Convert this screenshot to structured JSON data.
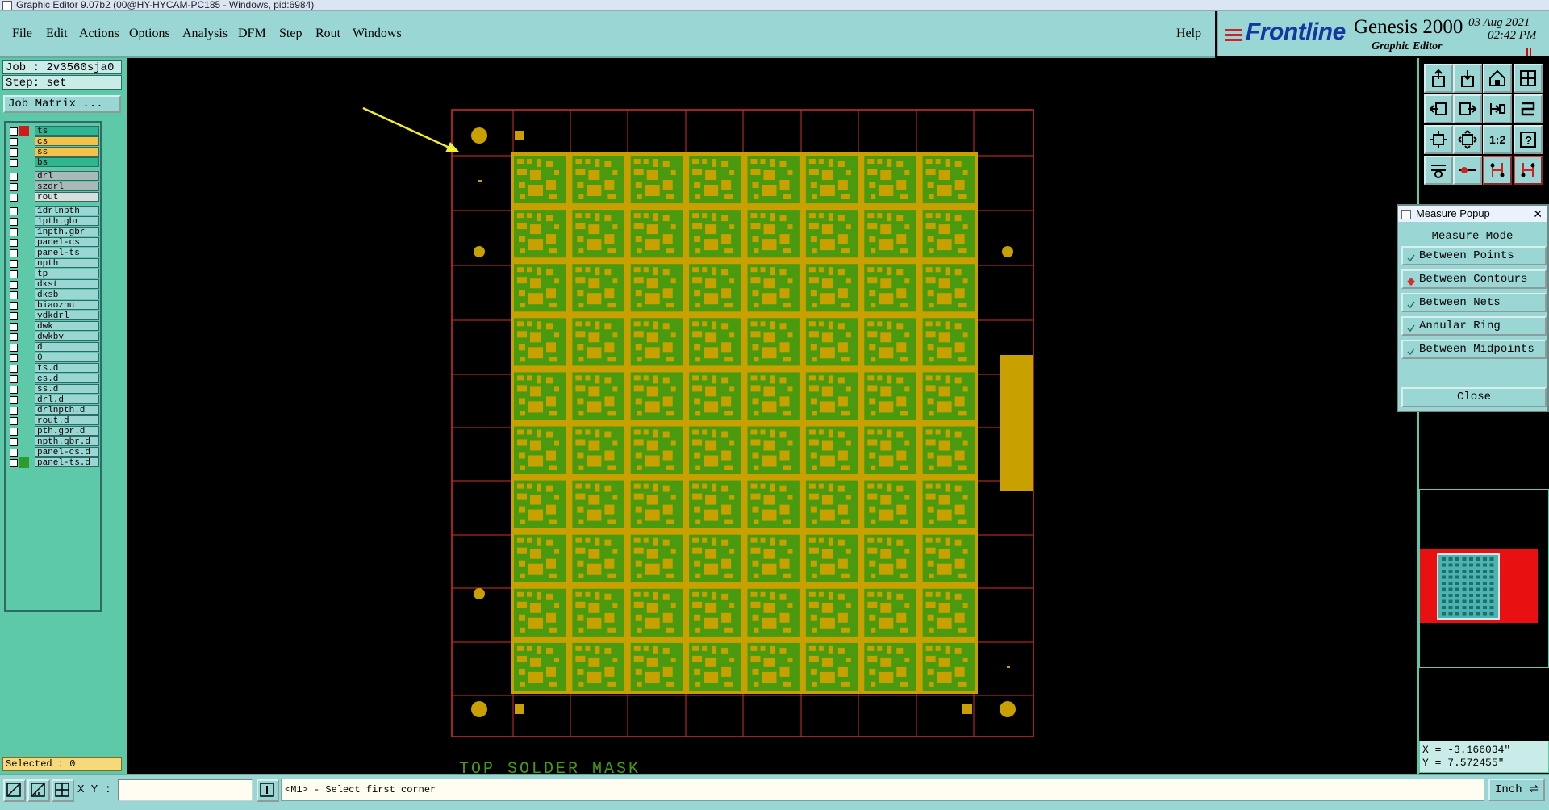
{
  "window": {
    "title": "Graphic Editor 9.07b2 (00@HY-HYCAM-PC185 - Windows, pid:6984)"
  },
  "menu": {
    "items": [
      {
        "key": "file",
        "label": "File"
      },
      {
        "key": "edit",
        "label": "Edit"
      },
      {
        "key": "actions",
        "label": "Actions"
      },
      {
        "key": "options",
        "label": "Options"
      },
      {
        "key": "analysis",
        "label": "Analysis"
      },
      {
        "key": "dfm",
        "label": "DFM"
      },
      {
        "key": "step",
        "label": "Step"
      },
      {
        "key": "rout",
        "label": "Rout"
      },
      {
        "key": "windows",
        "label": "Windows"
      }
    ],
    "help": "Help"
  },
  "brand": {
    "logo": "Frontline",
    "product": "Genesis 2000",
    "subtitle": "Graphic Editor",
    "date": "03 Aug 2021",
    "time": "02:42 PM"
  },
  "job": {
    "job_label": "Job : 2v3560sja0",
    "step_label": "Step: set",
    "matrix_button": "Job Matrix ..."
  },
  "layers": [
    {
      "name": "ts",
      "bg": "#2fb58f",
      "swatch": "#d11a1a",
      "group": 1
    },
    {
      "name": "cs",
      "bg": "#f5c24a",
      "swatch": "",
      "group": 1
    },
    {
      "name": "ss",
      "bg": "#f5c24a",
      "swatch": "",
      "group": 1
    },
    {
      "name": "bs",
      "bg": "#2fb58f",
      "swatch": "",
      "group": 1
    },
    {
      "name": "drl",
      "bg": "#a9b9ba",
      "swatch": "",
      "group": 2
    },
    {
      "name": "szdrl",
      "bg": "#a9b9ba",
      "swatch": "",
      "group": 2
    },
    {
      "name": "rout",
      "bg": "#d8dede",
      "swatch": "",
      "group": 2
    },
    {
      "name": "1drlnpth",
      "bg": "#9ad7d4",
      "swatch": "",
      "group": 3
    },
    {
      "name": "1pth.gbr",
      "bg": "#9ad7d4",
      "swatch": "",
      "group": 3
    },
    {
      "name": "1npth.gbr",
      "bg": "#9ad7d4",
      "swatch": "",
      "group": 3
    },
    {
      "name": "panel-cs",
      "bg": "#9ad7d4",
      "swatch": "",
      "group": 3
    },
    {
      "name": "panel-ts",
      "bg": "#9ad7d4",
      "swatch": "",
      "group": 3
    },
    {
      "name": "npth",
      "bg": "#9ad7d4",
      "swatch": "",
      "group": 3
    },
    {
      "name": "tp",
      "bg": "#9ad7d4",
      "swatch": "",
      "group": 3
    },
    {
      "name": "dkst",
      "bg": "#9ad7d4",
      "swatch": "",
      "group": 3
    },
    {
      "name": "dksb",
      "bg": "#9ad7d4",
      "swatch": "",
      "group": 3
    },
    {
      "name": "biaozhu",
      "bg": "#9ad7d4",
      "swatch": "",
      "group": 3
    },
    {
      "name": "ydkdrl",
      "bg": "#9ad7d4",
      "swatch": "",
      "group": 3
    },
    {
      "name": "dwk",
      "bg": "#9ad7d4",
      "swatch": "",
      "group": 3
    },
    {
      "name": "dwkby",
      "bg": "#9ad7d4",
      "swatch": "",
      "group": 3
    },
    {
      "name": "d",
      "bg": "#9ad7d4",
      "swatch": "",
      "group": 3
    },
    {
      "name": "0",
      "bg": "#9ad7d4",
      "swatch": "",
      "group": 3
    },
    {
      "name": "ts.d",
      "bg": "#9ad7d4",
      "swatch": "",
      "group": 3
    },
    {
      "name": "cs.d",
      "bg": "#9ad7d4",
      "swatch": "",
      "group": 3
    },
    {
      "name": "ss.d",
      "bg": "#9ad7d4",
      "swatch": "",
      "group": 3
    },
    {
      "name": "drl.d",
      "bg": "#9ad7d4",
      "swatch": "",
      "group": 3
    },
    {
      "name": "drlnpth.d",
      "bg": "#9ad7d4",
      "swatch": "",
      "group": 3
    },
    {
      "name": "rout.d",
      "bg": "#9ad7d4",
      "swatch": "",
      "group": 3
    },
    {
      "name": "pth.gbr.d",
      "bg": "#9ad7d4",
      "swatch": "",
      "group": 3
    },
    {
      "name": "npth.gbr.d",
      "bg": "#9ad7d4",
      "swatch": "",
      "group": 3
    },
    {
      "name": "panel-cs.d",
      "bg": "#9ad7d4",
      "swatch": "",
      "group": 3
    },
    {
      "name": "panel-ts.d",
      "bg": "#9ad7d4",
      "swatch": "#2d9c2d",
      "group": 3
    }
  ],
  "selected": "Selected : 0",
  "canvas": {
    "layer_caption": "TOP SOLDER MASK",
    "pcb_colors": {
      "board": "#c8a000",
      "trace": "#4a9a10",
      "grid": "#d0302a",
      "arrow": "#f2ee30"
    }
  },
  "toolbar_icons": [
    "open-in-icon",
    "save-in-icon",
    "home-icon",
    "split-view-icon",
    "back-icon",
    "forward-icon",
    "undo-icon",
    "redo-icon",
    "fit-icon",
    "zoom-fit-icon",
    "scale-1-2-icon",
    "question-icon",
    "snap-icon",
    "measure-icon",
    "net-icon",
    "net-highlight-icon"
  ],
  "measure_popup": {
    "title": "Measure Popup",
    "mode_label": "Measure Mode",
    "options": [
      {
        "label": "Between Points",
        "selected": false
      },
      {
        "label": "Between Contours",
        "selected": true
      },
      {
        "label": "Between Nets",
        "selected": false
      },
      {
        "label": "Annular Ring",
        "selected": false
      },
      {
        "label": "Between Midpoints",
        "selected": false
      }
    ],
    "close": "Close"
  },
  "coordinates": {
    "x_label": "X = -3.166034\"",
    "y_label": "Y = 7.572455\""
  },
  "status": {
    "xy_label": "X Y :",
    "xy_value": "",
    "message": "<M1> - Select first corner",
    "units": "Inch"
  }
}
